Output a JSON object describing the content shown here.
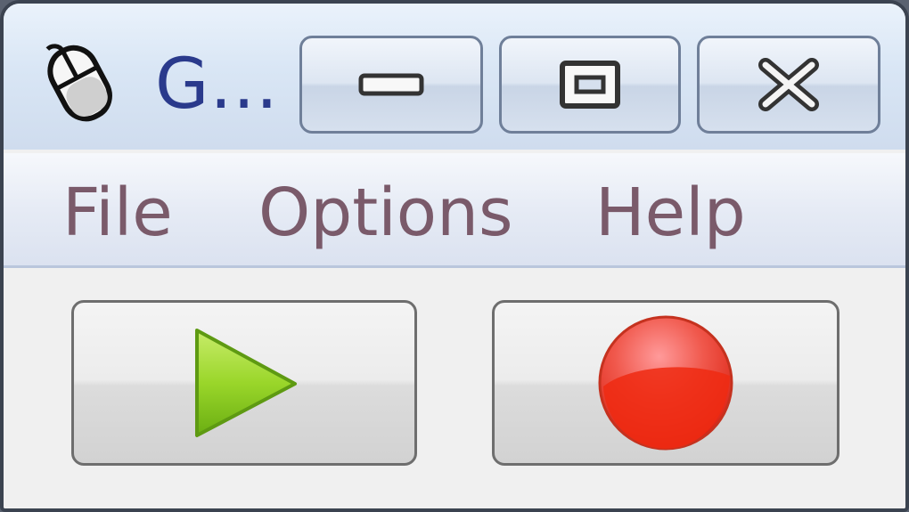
{
  "window": {
    "title": "G...",
    "caption_buttons": [
      "minimize",
      "maximize",
      "close"
    ]
  },
  "menubar": {
    "items": [
      "File",
      "Options",
      "Help"
    ]
  },
  "toolbar": {
    "buttons": [
      {
        "icon": "play-icon",
        "color": "#7cc51a"
      },
      {
        "icon": "record-icon",
        "color": "#e8200e"
      }
    ]
  },
  "colors": {
    "titlebar": "#d9e6f5",
    "menu_text": "#7a5a6a",
    "title_text": "#2a3a8c",
    "client_bg": "#f0f0f0"
  }
}
